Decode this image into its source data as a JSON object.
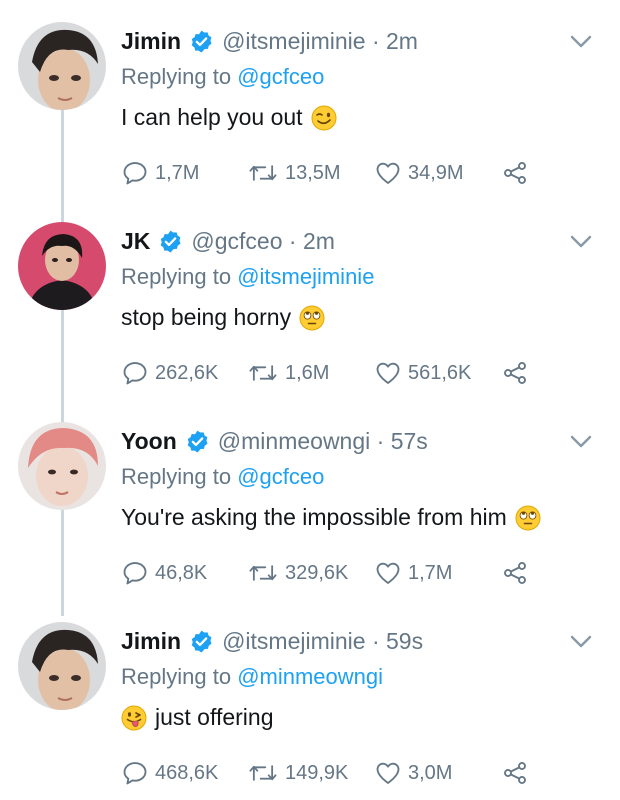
{
  "tweets": [
    {
      "name": "Jimin",
      "handle": "@itsmejiminie",
      "time": "· 2m",
      "replying_prefix": "Replying to ",
      "replying_to": "@gcfceo",
      "text": "I can help you out",
      "emoji": "winking-face",
      "replies": "1,7M",
      "retweets": "13,5M",
      "likes": "34,9M"
    },
    {
      "name": "JK",
      "handle": "@gcfceo",
      "time": "· 2m",
      "replying_prefix": "Replying to ",
      "replying_to": "@itsmejiminie",
      "text": "stop being horny",
      "emoji": "face-with-rolling-eyes",
      "replies": "262,6K",
      "retweets": "1,6M",
      "likes": "561,6K"
    },
    {
      "name": "Yoon",
      "handle": "@minmeowngi",
      "time": "· 57s",
      "replying_prefix": "Replying to ",
      "replying_to": "@gcfceo",
      "text": "You're asking the impossible from him",
      "emoji": "face-with-rolling-eyes",
      "replies": "46,8K",
      "retweets": "329,6K",
      "likes": "1,7M"
    },
    {
      "name": "Jimin",
      "handle": "@itsmejiminie",
      "time": "· 59s",
      "replying_prefix": "Replying to ",
      "replying_to": "@minmeowngi",
      "text": "just offering",
      "emoji": "winking-face-with-tongue",
      "replies": "468,6K",
      "retweets": "149,9K",
      "likes": "3,0M"
    }
  ],
  "colors": {
    "accent": "#1da1f2",
    "secondary_text": "#657786",
    "thread_line": "#ccd6dd"
  }
}
